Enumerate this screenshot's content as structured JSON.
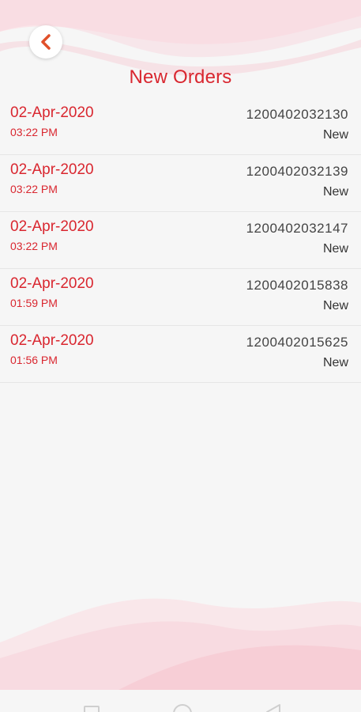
{
  "header": {
    "title": "New Orders"
  },
  "orders": [
    {
      "date": "02-Apr-2020",
      "time": "03:22 PM",
      "order_no": "1200402032130",
      "status": "New"
    },
    {
      "date": "02-Apr-2020",
      "time": "03:22 PM",
      "order_no": "1200402032139",
      "status": "New"
    },
    {
      "date": "02-Apr-2020",
      "time": "03:22 PM",
      "order_no": "1200402032147",
      "status": "New"
    },
    {
      "date": "02-Apr-2020",
      "time": "01:59 PM",
      "order_no": "1200402015838",
      "status": "New"
    },
    {
      "date": "02-Apr-2020",
      "time": "01:56 PM",
      "order_no": "1200402015625",
      "status": "New"
    }
  ],
  "colors": {
    "accent": "#d9262f",
    "accent_back": "#e0502a"
  },
  "icons": {
    "back": "chevron-left-icon"
  }
}
